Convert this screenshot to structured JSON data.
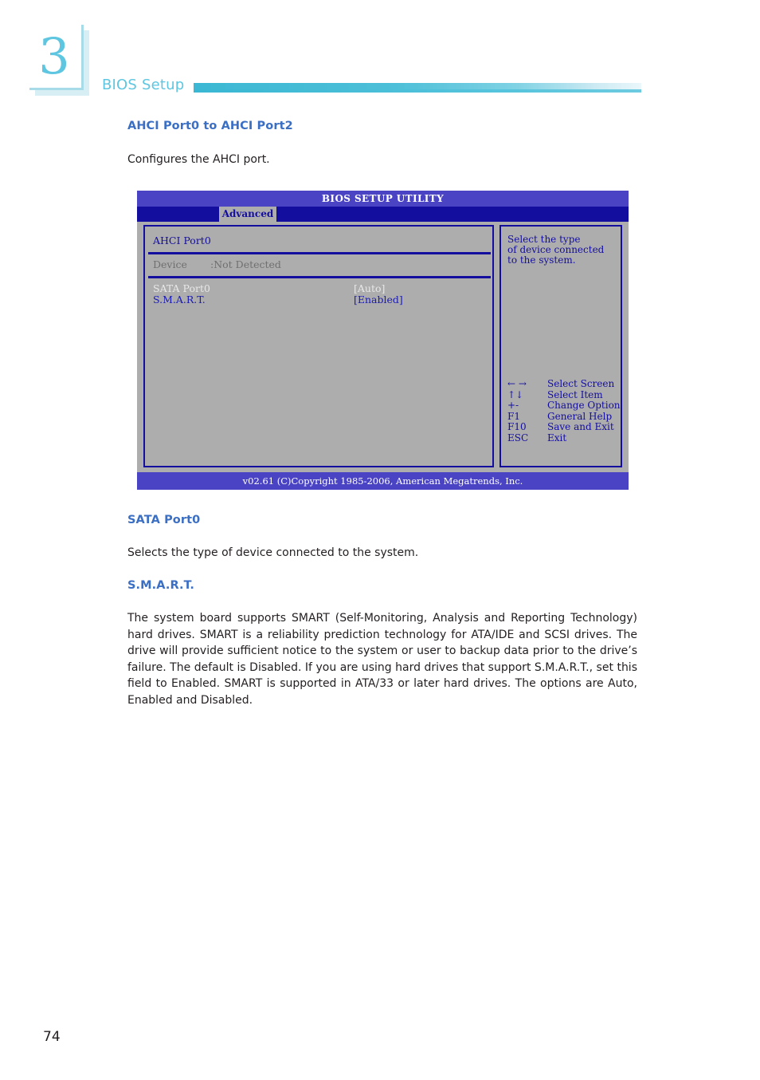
{
  "chapter": {
    "number": "3",
    "title": "BIOS Setup"
  },
  "page": {
    "number": "74"
  },
  "sections": [
    {
      "heading": "AHCI Port0 to AHCI Port2",
      "body": "Configures the AHCI port."
    },
    {
      "heading": "SATA Port0",
      "body": "Selects the type of device connected to the system."
    },
    {
      "heading": "S.M.A.R.T.",
      "body": "The system board supports SMART (Self-Monitoring, Analysis and Reporting Technology) hard drives. SMART is a reliability prediction technology for ATA/IDE and SCSI drives. The drive will provide sufficient notice to the system or user to backup data prior to the drive’s failure. The default is Disabled. If you are using hard drives that support S.M.A.R.T., set this field to Enabled. SMART is supported in ATA/33 or later hard drives. The options are Auto, Enabled and Disabled."
    }
  ],
  "bios": {
    "title": "BIOS SETUP UTILITY",
    "active_tab": "Advanced",
    "main": {
      "group_title": "AHCI Port0",
      "device_label": "Device",
      "device_value": ":Not Detected",
      "options": [
        {
          "label": "SATA Port0",
          "value": "[Auto]",
          "selected": false
        },
        {
          "label": "S.M.A.R.T.",
          "value": "[Enabled]",
          "selected": true
        }
      ]
    },
    "help": {
      "lines": [
        "Select the type",
        "of device connected",
        "to the system."
      ]
    },
    "legend": [
      {
        "key": "← →",
        "desc": "Select Screen"
      },
      {
        "key": "↑↓",
        "desc": "Select Item"
      },
      {
        "key": "+-",
        "desc": "Change Option"
      },
      {
        "key": "F1",
        "desc": "General Help"
      },
      {
        "key": "F10",
        "desc": "Save and Exit"
      },
      {
        "key": "ESC",
        "desc": "Exit"
      }
    ],
    "footer": "v02.61 (C)Copyright 1985-2006, American Megatrends, Inc."
  },
  "colors": {
    "accent_teal": "#5ec6e0",
    "heading_blue": "#3b6fc4",
    "bios_titlebar": "#4a44c4",
    "bios_tabbar": "#140e9e",
    "bios_body": "#adadad",
    "bios_navy_text": "#140e9e"
  }
}
